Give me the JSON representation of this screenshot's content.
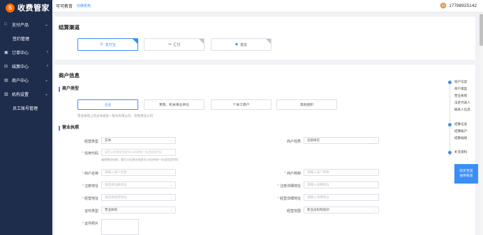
{
  "app": {
    "logo_mark": "S",
    "logo_text": "收费管家"
  },
  "sidebar": {
    "items": [
      {
        "label": "支付产品",
        "icon": "□",
        "chev": "⌄"
      },
      {
        "label": "签约管理"
      },
      {
        "label": "订单中心",
        "icon": "▣",
        "chev": "›"
      },
      {
        "label": "结算中心",
        "icon": "⊟",
        "chev": "›"
      },
      {
        "label": "商户中心",
        "icon": "▤",
        "chev": "⌄"
      },
      {
        "label": "机构设置",
        "icon": "▥",
        "chev": "⌄"
      },
      {
        "label": "员工账号管理"
      }
    ]
  },
  "topbar": {
    "brand": "可可教育",
    "tag": "切换机构",
    "phone": "17788925142"
  },
  "settlement": {
    "title": "结算渠道",
    "options": [
      {
        "label": "支付宝",
        "icon": "⊙"
      },
      {
        "label": "汇付",
        "icon": "↝"
      },
      {
        "label": "富友",
        "icon": "◆"
      }
    ]
  },
  "merchant": {
    "title": "商户信息",
    "type_section": "商户类型",
    "types": [
      "企业",
      "党政、机关事业单位",
      "个体工商户",
      "其他组织"
    ],
    "type_hint": "营业执照上的主体类型一般为有限公司、有限责任公司",
    "license_section": "营业执照",
    "fields": {
      "biz_type": {
        "label": "经营类型",
        "value": "实体"
      },
      "merchant_nature": {
        "label": "商户性质",
        "value": "连锁商店"
      },
      "credit_code": {
        "label": "信用代码",
        "placeholder": "请写15位营业执照号/18位的统一社会信用代码"
      },
      "credit_hint": "请按营业执照，填写15位营业执照号/18位的统一社会信用代码",
      "merchant_name": {
        "label": "商户名称",
        "placeholder": "请输入商户名称"
      },
      "merchant_short": {
        "label": "商户简称",
        "placeholder": "请输入商户简称"
      },
      "reg_addr": {
        "label": "注册地址",
        "placeholder": "请选择注册地址"
      },
      "reg_detail": {
        "label": "注册详细地址",
        "placeholder": "请输入详细地址"
      },
      "op_addr": {
        "label": "经营地址",
        "placeholder": "请选择经营地址"
      },
      "op_detail": {
        "label": "经营详细地址",
        "placeholder": "请输入详细地址"
      },
      "cert_type": {
        "label": "证件类型",
        "value": "营业执照"
      },
      "biz_scope": {
        "label": "经营范围",
        "value": "新业态机构培训"
      },
      "cert_photo": {
        "label": "证件照片"
      }
    }
  },
  "anchor_nav": {
    "groups": [
      [
        "商户信息",
        "商户类型",
        "营业执照",
        "法定代表人",
        "联系人信息"
      ],
      [
        "结算信息",
        "结算账户",
        "结算规则"
      ],
      [
        "补充资料"
      ]
    ]
  },
  "float_button": {
    "line1": "同步至其",
    "line2": "他所有店"
  },
  "colors": {
    "sidebar_bg": "#1f2d4d",
    "accent": "#3a8ef6",
    "logo": "#ff6a00"
  }
}
